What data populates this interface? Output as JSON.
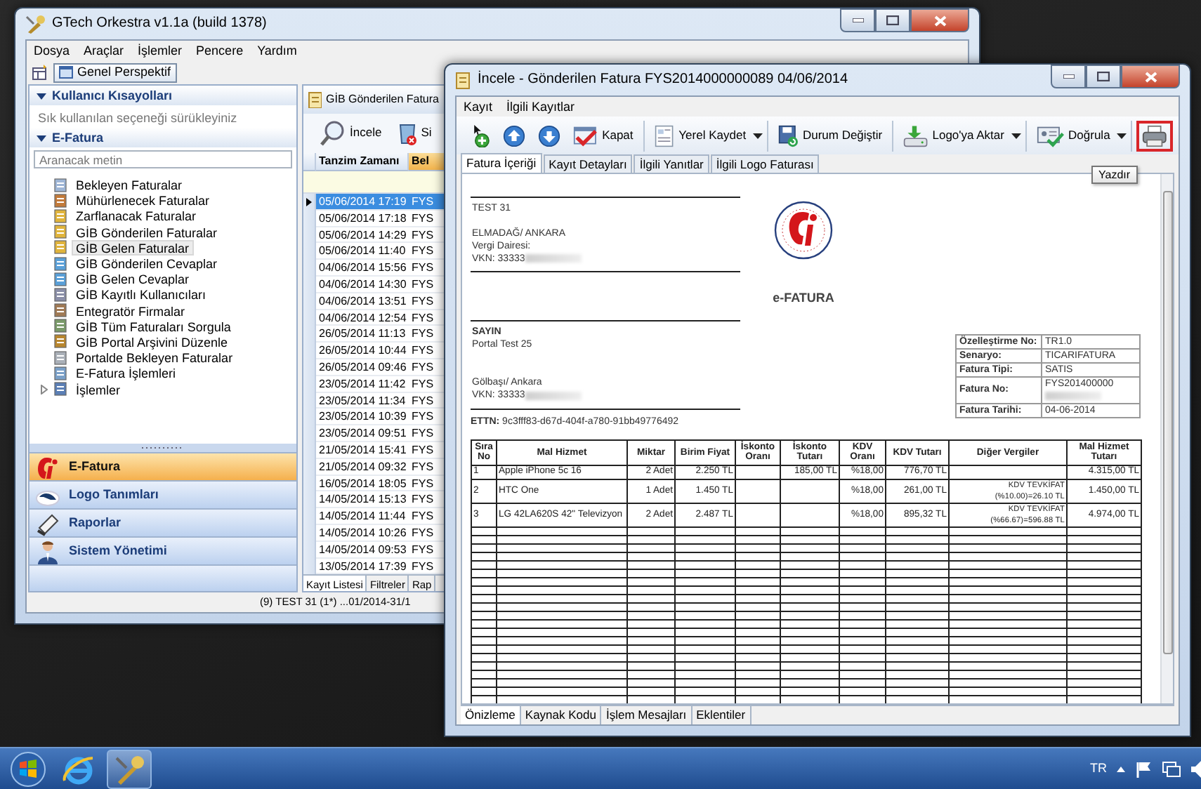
{
  "main_window": {
    "title": "GTech Orkestra v1.1a (build 1378)",
    "menu": [
      "Dosya",
      "Araçlar",
      "İşlemler",
      "Pencere",
      "Yardım"
    ],
    "perspective_button": "Genel Perspektif",
    "sidebar": {
      "shortcuts": {
        "title": "Kullanıcı Kısayolları",
        "expanded": true,
        "hint": "Sık kullanılan seçeneği sürükleyiniz"
      },
      "efatura": {
        "title": "E-Fatura",
        "expanded": true,
        "search": {
          "placeholder": "Aranacak metin"
        },
        "items": [
          {
            "label": "Bekleyen Faturalar",
            "selected": false
          },
          {
            "label": "Mühürlenecek Faturalar",
            "selected": false
          },
          {
            "label": "Zarflanacak Faturalar",
            "selected": false
          },
          {
            "label": "GİB Gönderilen Faturalar",
            "selected": false
          },
          {
            "label": "GİB Gelen Faturalar",
            "selected": true
          },
          {
            "label": "GİB Gönderilen Cevaplar",
            "selected": false
          },
          {
            "label": "GİB Gelen Cevaplar",
            "selected": false
          },
          {
            "label": "GİB Kayıtlı Kullanıcıları",
            "selected": false
          },
          {
            "label": "Entegratör Firmalar",
            "selected": false
          },
          {
            "label": "GİB Tüm Faturaları Sorgula",
            "selected": false
          },
          {
            "label": "GİB Portal Arşivini Düzenle",
            "selected": false
          },
          {
            "label": "Portalde Bekleyen Faturalar",
            "selected": false
          },
          {
            "label": "E-Fatura İşlemleri",
            "selected": false
          },
          {
            "label": "İşlemler",
            "selected": false,
            "expanded": false
          }
        ]
      },
      "nav_buttons": [
        {
          "label": "E-Fatura",
          "selected": true
        },
        {
          "label": "Logo Tanımları",
          "selected": false
        },
        {
          "label": "Raporlar",
          "selected": false
        },
        {
          "label": "Sistem Yönetimi",
          "selected": false
        }
      ]
    },
    "list_panel": {
      "title": "GİB Gönderilen Fatura",
      "toolbar": [
        {
          "kind": "inspect",
          "label": "İncele"
        },
        {
          "kind": "delete",
          "label": "Si"
        }
      ],
      "columns": [
        {
          "label": "Tanzim Zamanı",
          "sorted": false
        },
        {
          "label": "Bel",
          "sorted": true
        }
      ],
      "rows": [
        {
          "cells": [
            "05/06/2014 17:19",
            "FYS"
          ],
          "selected": true
        },
        {
          "cells": [
            "05/06/2014 17:18",
            "FYS"
          ],
          "selected": false
        },
        {
          "cells": [
            "05/06/2014 14:29",
            "FYS"
          ],
          "selected": false
        },
        {
          "cells": [
            "05/06/2014 11:40",
            "FYS"
          ],
          "selected": false
        },
        {
          "cells": [
            "04/06/2014 15:56",
            "FYS"
          ],
          "selected": false
        },
        {
          "cells": [
            "04/06/2014 14:30",
            "FYS"
          ],
          "selected": false
        },
        {
          "cells": [
            "04/06/2014 13:51",
            "FYS"
          ],
          "selected": false
        },
        {
          "cells": [
            "04/06/2014 12:54",
            "FYS"
          ],
          "selected": false
        },
        {
          "cells": [
            "26/05/2014 11:13",
            "FYS"
          ],
          "selected": false
        },
        {
          "cells": [
            "26/05/2014 10:44",
            "FYS"
          ],
          "selected": false
        },
        {
          "cells": [
            "26/05/2014 09:46",
            "FYS"
          ],
          "selected": false
        },
        {
          "cells": [
            "23/05/2014 11:42",
            "FYS"
          ],
          "selected": false
        },
        {
          "cells": [
            "23/05/2014 11:34",
            "FYS"
          ],
          "selected": false
        },
        {
          "cells": [
            "23/05/2014 10:39",
            "FYS"
          ],
          "selected": false
        },
        {
          "cells": [
            "23/05/2014 09:51",
            "FYS"
          ],
          "selected": false
        },
        {
          "cells": [
            "21/05/2014 15:41",
            "FYS"
          ],
          "selected": false
        },
        {
          "cells": [
            "21/05/2014 09:32",
            "FYS"
          ],
          "selected": false
        },
        {
          "cells": [
            "16/05/2014 18:05",
            "FYS"
          ],
          "selected": false
        },
        {
          "cells": [
            "14/05/2014 15:13",
            "FYS"
          ],
          "selected": false
        },
        {
          "cells": [
            "14/05/2014 11:44",
            "FYS"
          ],
          "selected": false
        },
        {
          "cells": [
            "14/05/2014 10:26",
            "FYS"
          ],
          "selected": false
        },
        {
          "cells": [
            "14/05/2014 09:53",
            "FYS"
          ],
          "selected": false
        },
        {
          "cells": [
            "13/05/2014 17:39",
            "FYS"
          ],
          "selected": false
        }
      ],
      "tabs": [
        {
          "label": "Kayıt Listesi",
          "selected": true
        },
        {
          "label": "Filtreler",
          "selected": false
        },
        {
          "label": "Rap",
          "selected": false
        }
      ]
    },
    "status_bar": "(9) TEST 31  (1*) ...01/2014-31/1"
  },
  "dialog": {
    "title": "İncele - Gönderilen Fatura FYS2014000000089 04/06/2014",
    "menu": [
      "Kayıt",
      "İlgili Kayıtlar"
    ],
    "toolbar": [
      [
        {
          "kind": "add"
        },
        {
          "kind": "up"
        },
        {
          "kind": "down"
        },
        {
          "kind": "close",
          "label": "Kapat"
        }
      ],
      [
        {
          "kind": "export",
          "label": "Yerel Kaydet",
          "dropdown": true
        }
      ],
      [
        {
          "kind": "status",
          "label": "Durum Değiştir"
        }
      ],
      [
        {
          "kind": "transfer",
          "label": "Logo'ya Aktar",
          "dropdown": true
        }
      ],
      [
        {
          "kind": "verify",
          "label": "Doğrula",
          "dropdown": true
        }
      ],
      [
        {
          "kind": "print",
          "highlighted": true,
          "tooltip": "Yazdır"
        }
      ]
    ],
    "tabs": [
      {
        "label": "Fatura İçeriği",
        "selected": true
      },
      {
        "label": "Kayıt Detayları",
        "selected": false
      },
      {
        "label": "İlgili Yanıtlar",
        "selected": false
      },
      {
        "label": "İlgili Logo Faturası",
        "selected": false
      }
    ],
    "document": {
      "seller": {
        "name": "TEST 31",
        "address": "ELMADAĞ/ ANKARA",
        "tax_office": "Vergi Dairesi:",
        "tax_id": "VKN: 33333"
      },
      "title": "e-FATURA",
      "buyer": {
        "heading": "SAYIN",
        "name": "Portal Test 25",
        "address": "Gölbaşı/ Ankara",
        "tax_id": "VKN: 33333"
      },
      "ettn": "**ETTN:** 9c3fff83-d67d-404f-a780-91bb49776492",
      "info": [
        {
          "label": "Özelleştirme No:",
          "value": "TR1.0"
        },
        {
          "label": "Senaryo:",
          "value": "TICARIFATURA"
        },
        {
          "label": "Fatura Tipi:",
          "value": "SATIS"
        },
        {
          "label": "Fatura No:",
          "value": "FYS201400000"
        },
        {
          "label": "Fatura Tarihi:",
          "value": "04-06-2014"
        }
      ],
      "items_table": {
        "columns": [
          "Sıra No",
          "Mal Hizmet",
          "Miktar",
          "Birim Fiyat",
          "İskonto Oranı",
          "İskonto Tutarı",
          "KDV Oranı",
          "KDV Tutarı",
          "Diğer Vergiler",
          "Mal Hizmet Tutarı"
        ],
        "rows": [
          [
            "1",
            "Apple iPhone 5c 16",
            "2 Adet",
            "2.250 TL",
            null,
            "185,00 TL",
            "%18,00",
            "776,70 TL",
            null,
            "4.315,00 TL"
          ],
          [
            "2",
            "HTC One",
            "1 Adet",
            "1.450 TL",
            null,
            null,
            "%18,00",
            "261,00 TL",
            "KDV TEVKİFAT (%10.00)=26.10 TL",
            "1.450,00 TL"
          ],
          [
            "3",
            "LG 42LA620S 42\" Televizyon",
            "2 Adet",
            "2.487 TL",
            null,
            null,
            "%18,00",
            "895,32 TL",
            "KDV TEVKİFAT (%66.67)=596.88 TL",
            "4.974,00 TL"
          ]
        ]
      }
    },
    "bottom_tabs": [
      {
        "label": "Önizleme",
        "selected": true
      },
      {
        "label": "Kaynak Kodu",
        "selected": false
      },
      {
        "label": "İşlem Mesajları",
        "selected": false
      },
      {
        "label": "Eklentiler",
        "selected": false
      }
    ]
  },
  "taskbar": {
    "language": "TR"
  }
}
